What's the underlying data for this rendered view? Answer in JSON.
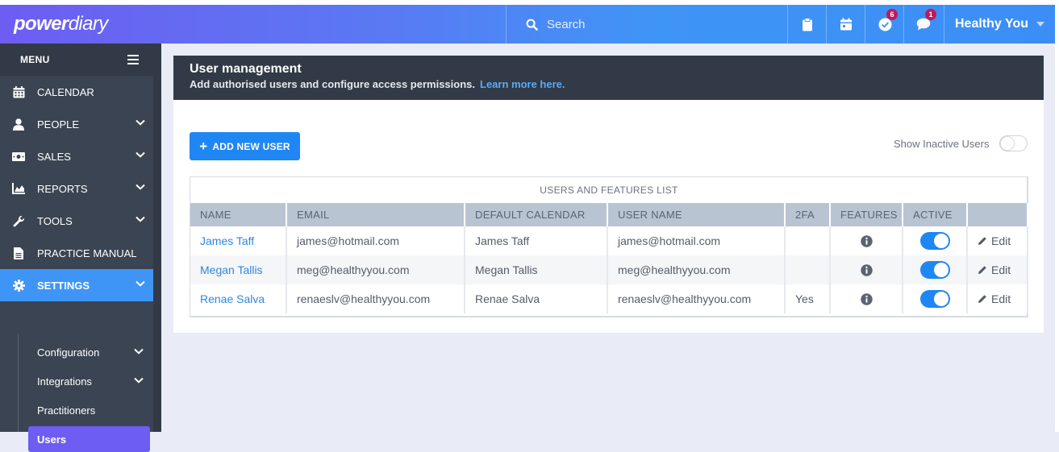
{
  "app": {
    "logo_bold": "power",
    "logo_rest": "diary"
  },
  "topbar": {
    "search_placeholder": "Search",
    "tasks_badge": "6",
    "messages_badge": "1",
    "user_name": "Healthy You"
  },
  "sidebar": {
    "menu_label": "MENU",
    "items": [
      {
        "label": "CALENDAR",
        "icon": "calendar-icon"
      },
      {
        "label": "PEOPLE",
        "icon": "person-icon"
      },
      {
        "label": "SALES",
        "icon": "money-icon"
      },
      {
        "label": "REPORTS",
        "icon": "chart-icon"
      },
      {
        "label": "TOOLS",
        "icon": "wrench-icon"
      },
      {
        "label": "PRACTICE MANUAL",
        "icon": "document-icon"
      },
      {
        "label": "SETTINGS",
        "icon": "gear-icon"
      }
    ],
    "sub_items": [
      {
        "label": "Configuration"
      },
      {
        "label": "Integrations"
      },
      {
        "label": "Practitioners"
      },
      {
        "label": "Users"
      }
    ]
  },
  "page": {
    "title": "User management",
    "subtitle": "Add authorised users and configure access permissions.",
    "learn_more": "Learn more here.",
    "add_button": "ADD NEW USER",
    "show_inactive_label": "Show Inactive Users",
    "table_caption": "USERS AND FEATURES LIST",
    "columns": [
      "NAME",
      "EMAIL",
      "DEFAULT CALENDAR",
      "USER NAME",
      "2FA",
      "FEATURES",
      "ACTIVE",
      ""
    ],
    "rows": [
      {
        "name": "James Taff",
        "email": "james@hotmail.com",
        "calendar": "James Taff",
        "username": "james@hotmail.com",
        "twofa": "",
        "active": true,
        "edit": "Edit"
      },
      {
        "name": "Megan Tallis",
        "email": "meg@healthyyou.com",
        "calendar": "Megan Tallis",
        "username": "meg@healthyyou.com",
        "twofa": "",
        "active": true,
        "edit": "Edit"
      },
      {
        "name": "Renae Salva",
        "email": "renaeslv@healthyyou.com",
        "calendar": "Renae Salva",
        "username": "renaeslv@healthyyou.com",
        "twofa": "Yes",
        "active": true,
        "edit": "Edit"
      }
    ]
  },
  "colors": {
    "accent": "#1f87f3",
    "sidebar_bg": "#3b4452",
    "header_dark": "#313a46",
    "selected_sub": "#6d5df2"
  }
}
